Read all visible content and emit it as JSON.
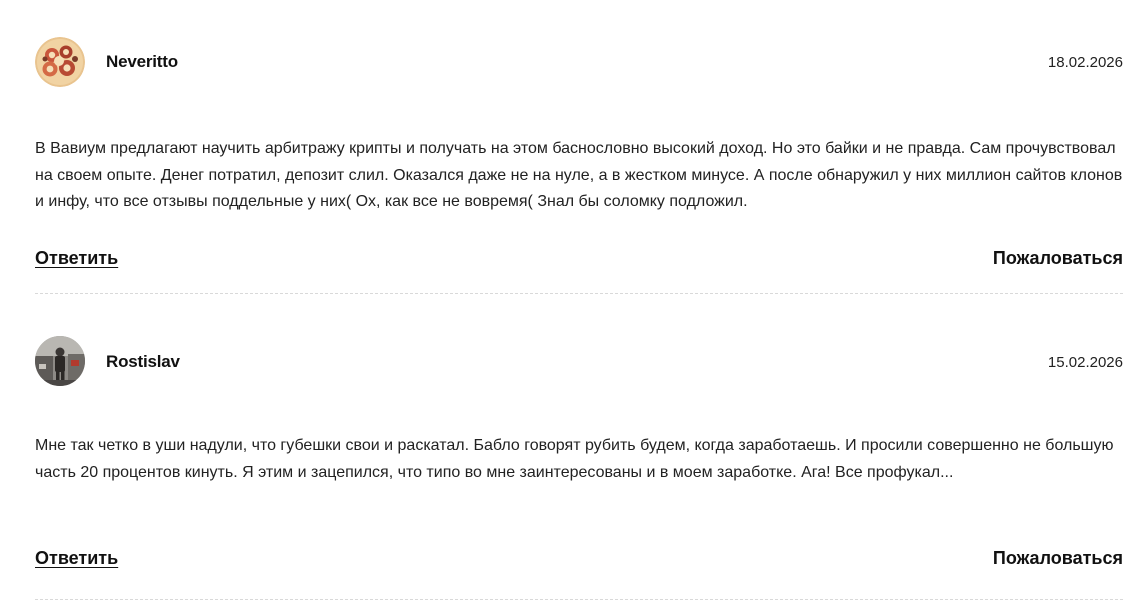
{
  "comments": [
    {
      "author": "Neveritto",
      "date": "18.02.2026",
      "text": "В Вавиум предлагают научить арбитражу крипты и получать на этом баснословно высокий доход. Но это байки и не правда. Сам прочувствовал на своем опыте. Денег потратил, депозит слил. Оказался даже не на нуле, а в жестком минусе. А после обнаружил у них миллион сайтов клонов и инфу, что все отзывы поддельные у них( Ох, как все не вовремя( Знал бы соломку подложил.",
      "reply_label": "Ответить",
      "report_label": "Пожаловаться",
      "avatar_icon": "avatar-illustrated-faces-icon"
    },
    {
      "author": "Rostislav",
      "date": "15.02.2026",
      "text": "Мне так четко в уши надули, что губешки свои и раскатал. Бабло говорят рубить будем, когда заработаешь. И просили совершенно не большую часть 20 процентов кинуть. Я этим и зацепился, что типо во мне заинтересованы и в моем заработке. Ага! Все профукал...",
      "reply_label": "Ответить",
      "report_label": "Пожаловаться",
      "avatar_icon": "avatar-photo-person-icon"
    }
  ],
  "colors": {
    "text": "#222222",
    "divider": "#d9d9d9",
    "background": "#ffffff"
  }
}
